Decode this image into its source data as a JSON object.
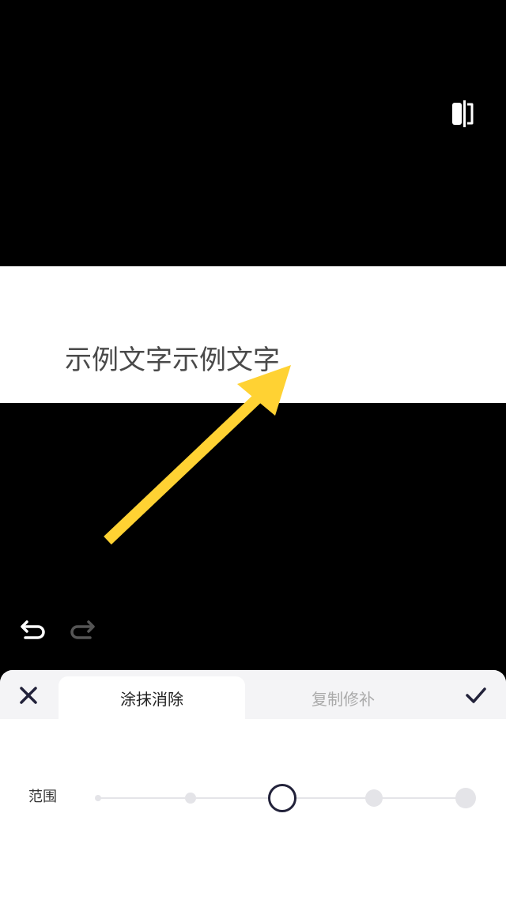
{
  "toolbar": {
    "compare_icon": "split-compare-icon"
  },
  "canvas": {
    "sample_text": "示例文字示例文字",
    "arrow_color": "#FFD233"
  },
  "history": {
    "undo_icon": "undo-icon",
    "redo_icon": "redo-icon"
  },
  "panel": {
    "tabs": [
      {
        "label": "涂抹消除",
        "active": true
      },
      {
        "label": "复制修补",
        "active": false
      }
    ],
    "close_icon": "close-icon",
    "confirm_icon": "check-icon",
    "range": {
      "label": "范围",
      "steps": 5,
      "selected_index": 2
    }
  }
}
